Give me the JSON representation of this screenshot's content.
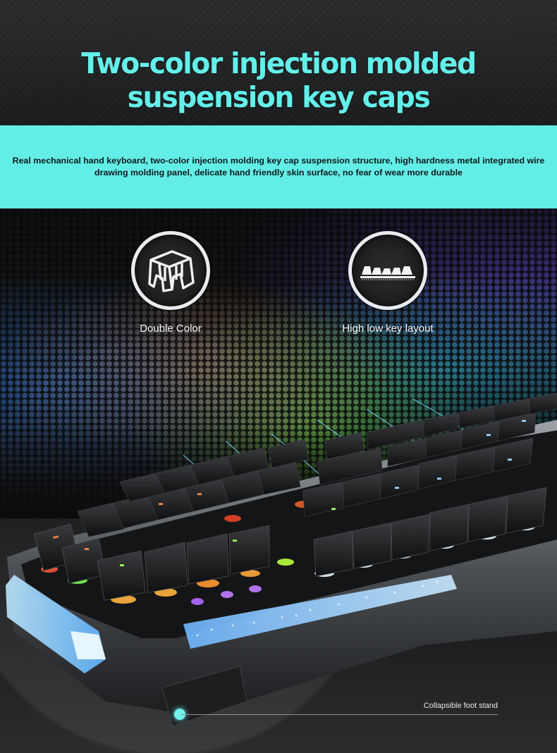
{
  "headline": "Two-color injection molded suspension key caps",
  "description": "Real mechanical hand keyboard, two-color injection molding key cap suspension structure, high hardness metal integrated wire drawing molding panel, delicate hand friendly skin surface, no fear of wear more durable",
  "features": [
    {
      "icon": "double-color-keycap-icon",
      "label": "Double Color"
    },
    {
      "icon": "high-low-key-layout-icon",
      "label": "High low key layout"
    }
  ],
  "callout": {
    "label": "Collapsible foot stand"
  },
  "colors": {
    "accent": "#63f0ea",
    "band": "#63ede7",
    "background": "#0b0b0c"
  }
}
